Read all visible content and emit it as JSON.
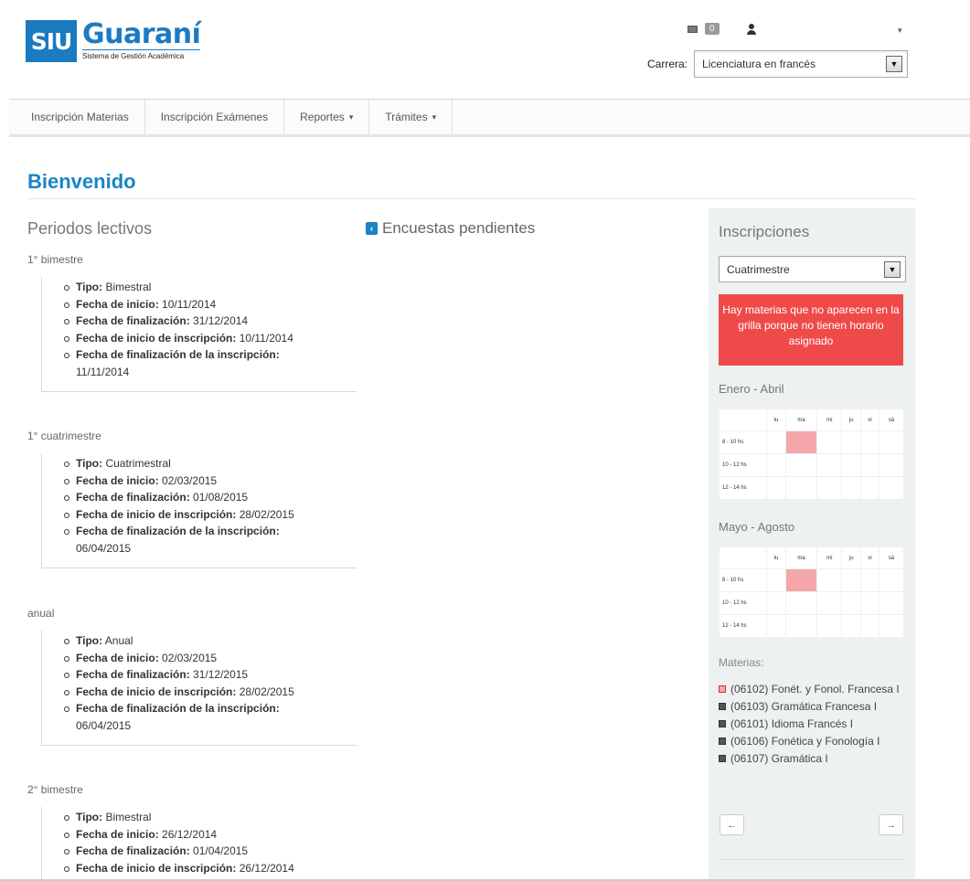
{
  "logo": {
    "badge": "SIU",
    "name": "Guaraní",
    "subtitle": "Sistema de Gestión Académica"
  },
  "header": {
    "messages_count": "0",
    "carrera_label": "Carrera:",
    "carrera_value": "Licenciatura en francés"
  },
  "nav": {
    "items": [
      {
        "label": "Inscripción Materias"
      },
      {
        "label": "Inscripción Exámenes"
      },
      {
        "label": "Reportes"
      },
      {
        "label": "Trámites"
      }
    ]
  },
  "page": {
    "title": "Bienvenido"
  },
  "periodos": {
    "title": "Periodos lectivos",
    "labels": {
      "tipo": "Tipo:",
      "inicio": "Fecha de inicio:",
      "fin": "Fecha de finalización:",
      "inicio_insc": "Fecha de inicio de inscripción:",
      "fin_insc": "Fecha de finalización de la inscripción:"
    },
    "items": [
      {
        "name": "1° bimestre",
        "tipo": "Bimestral",
        "inicio": "10/11/2014",
        "fin": "31/12/2014",
        "inicio_insc": "10/11/2014",
        "fin_insc": "11/11/2014"
      },
      {
        "name": "1° cuatrimestre",
        "tipo": "Cuatrimestral",
        "inicio": "02/03/2015",
        "fin": "01/08/2015",
        "inicio_insc": "28/02/2015",
        "fin_insc": "06/04/2015"
      },
      {
        "name": "anual",
        "tipo": "Anual",
        "inicio": "02/03/2015",
        "fin": "31/12/2015",
        "inicio_insc": "28/02/2015",
        "fin_insc": "06/04/2015"
      },
      {
        "name": "2° bimestre",
        "tipo": "Bimestral",
        "inicio": "26/12/2014",
        "fin": "01/04/2015",
        "inicio_insc": "26/12/2014"
      }
    ]
  },
  "encuestas": {
    "title": "Encuestas pendientes"
  },
  "inscripciones": {
    "title": "Inscripciones",
    "select_value": "Cuatrimestre",
    "alert": "Hay materias que no aparecen en la grilla porque no tienen horario asignado",
    "days": [
      "lu",
      "ma",
      "mi",
      "ju",
      "vi",
      "sá"
    ],
    "hours": [
      "8 - 10 hs",
      "10 - 12 hs",
      "12 - 14 hs"
    ],
    "periods": [
      {
        "label": "Enero - Abril"
      },
      {
        "label": "Mayo - Agosto"
      }
    ],
    "materias_label": "Materias:",
    "materias": [
      {
        "text": "(06102) Fonét. y Fonol. Francesa I",
        "color": "#f4a6aa"
      },
      {
        "text": "(06103) Gramática Francesa I",
        "color": "#555555"
      },
      {
        "text": "(06101) Idioma Francés I",
        "color": "#555555"
      },
      {
        "text": "(06106) Fonética y Fonología I",
        "color": "#555555"
      },
      {
        "text": "(06107) Gramática I",
        "color": "#555555"
      }
    ],
    "prev_label": "←",
    "next_label": "→"
  }
}
